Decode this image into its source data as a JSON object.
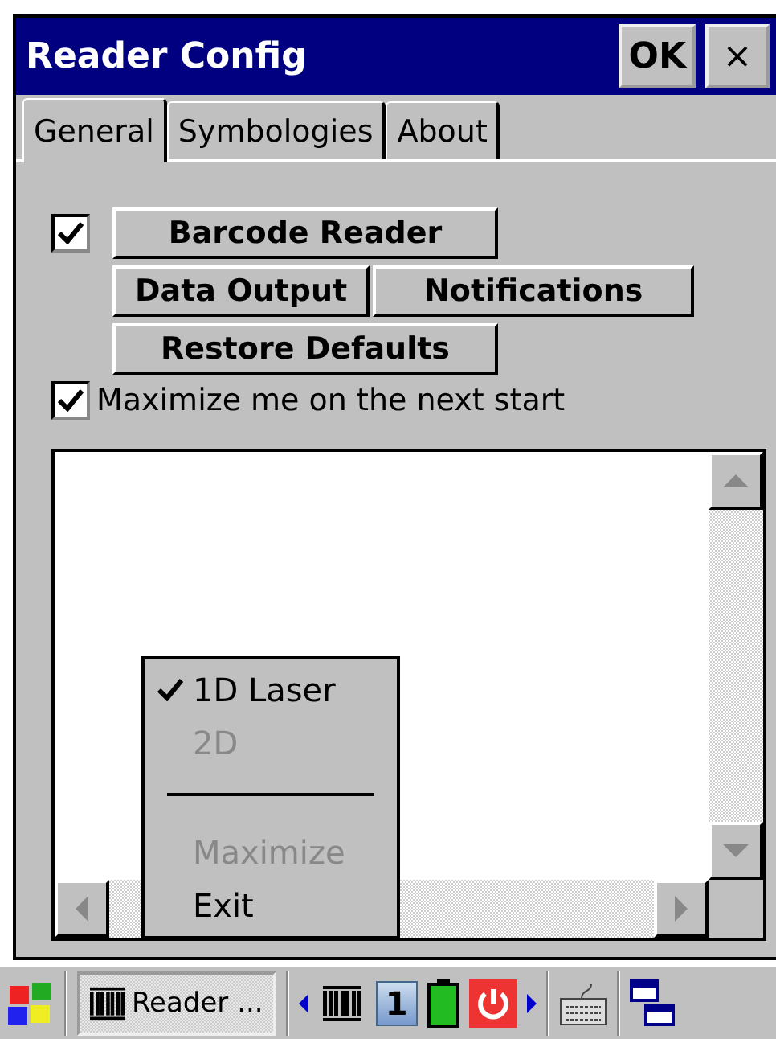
{
  "window": {
    "title": "Reader Config",
    "ok_button": "OK",
    "close_button": "×"
  },
  "tabs": [
    {
      "label": "General",
      "selected": true
    },
    {
      "label": "Symbologies",
      "selected": false
    },
    {
      "label": "About",
      "selected": false
    }
  ],
  "reader_checkbox": {
    "checked": true
  },
  "buttons": [
    {
      "label": "Barcode Reader"
    },
    {
      "label": "Data Output"
    },
    {
      "label": "Notifications"
    },
    {
      "label": "Restore Defaults"
    }
  ],
  "maximize_checkbox": {
    "label": "Maximize me on the next start",
    "checked": true
  },
  "popup_menu": [
    {
      "kind": "item",
      "label": "1D Laser",
      "checked": true,
      "disabled": false
    },
    {
      "kind": "item",
      "label": "2D",
      "checked": false,
      "disabled": true
    },
    {
      "kind": "separator"
    },
    {
      "kind": "item",
      "label": "Maximize",
      "checked": false,
      "disabled": true
    },
    {
      "kind": "item",
      "label": "Exit",
      "checked": false,
      "disabled": false
    }
  ],
  "taskbar": {
    "task_label": "Reader ...",
    "indicator": "1"
  }
}
